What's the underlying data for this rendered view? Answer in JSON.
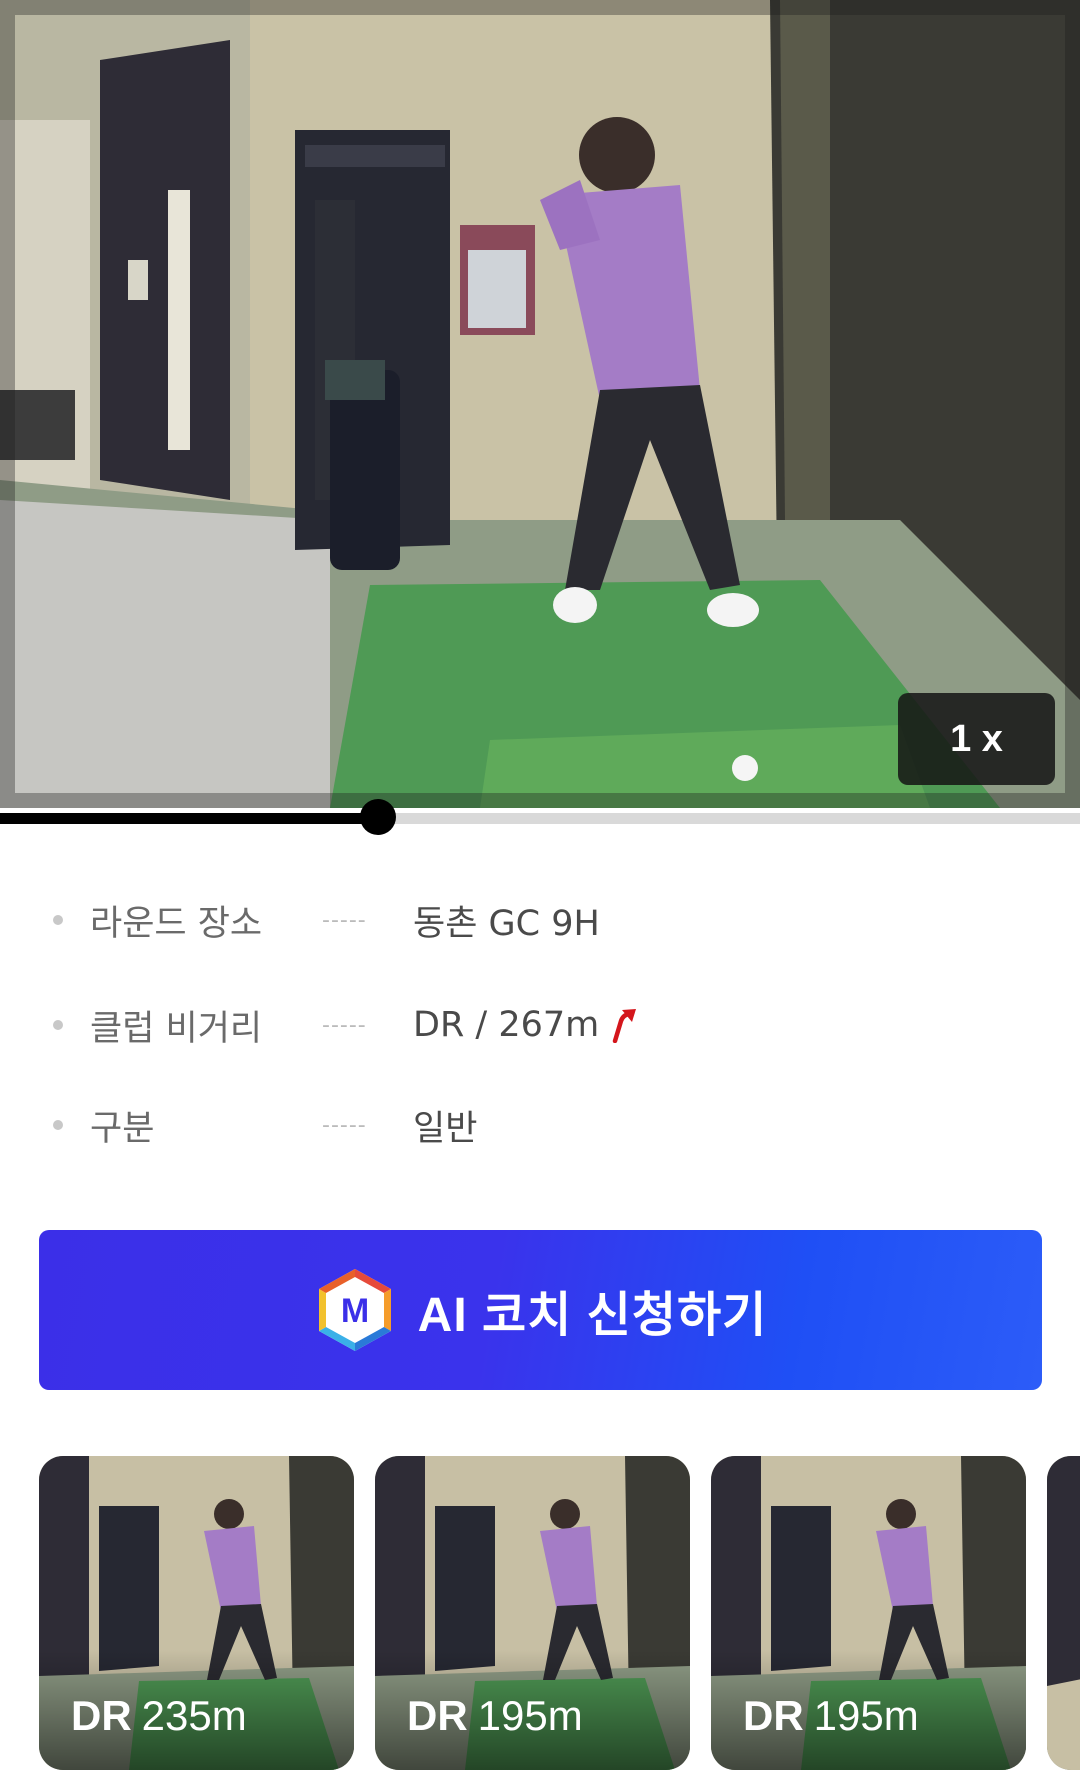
{
  "video": {
    "playback_speed": "1 x",
    "progress_fraction": 0.35
  },
  "info": {
    "rows": [
      {
        "label": "라운드 장소",
        "separator": "-----",
        "value": "동촌 GC 9H"
      },
      {
        "label": "클럽 비거리",
        "separator": "-----",
        "value": "DR / 267m"
      },
      {
        "label": "구분",
        "separator": "-----",
        "value": "일반"
      }
    ],
    "trend_icon": "up-right-arrow-icon",
    "trend_color": "#d4161c"
  },
  "coach_button": {
    "logo_letter": "M",
    "label": "AI 코치 신청하기",
    "gradient_start": "#3b2fe8",
    "gradient_end": "#2c5cf8"
  },
  "thumbnails": [
    {
      "club": "DR",
      "distance": "235m"
    },
    {
      "club": "DR",
      "distance": "195m"
    },
    {
      "club": "DR",
      "distance": "195m"
    },
    {
      "club": "",
      "distance": ""
    }
  ]
}
